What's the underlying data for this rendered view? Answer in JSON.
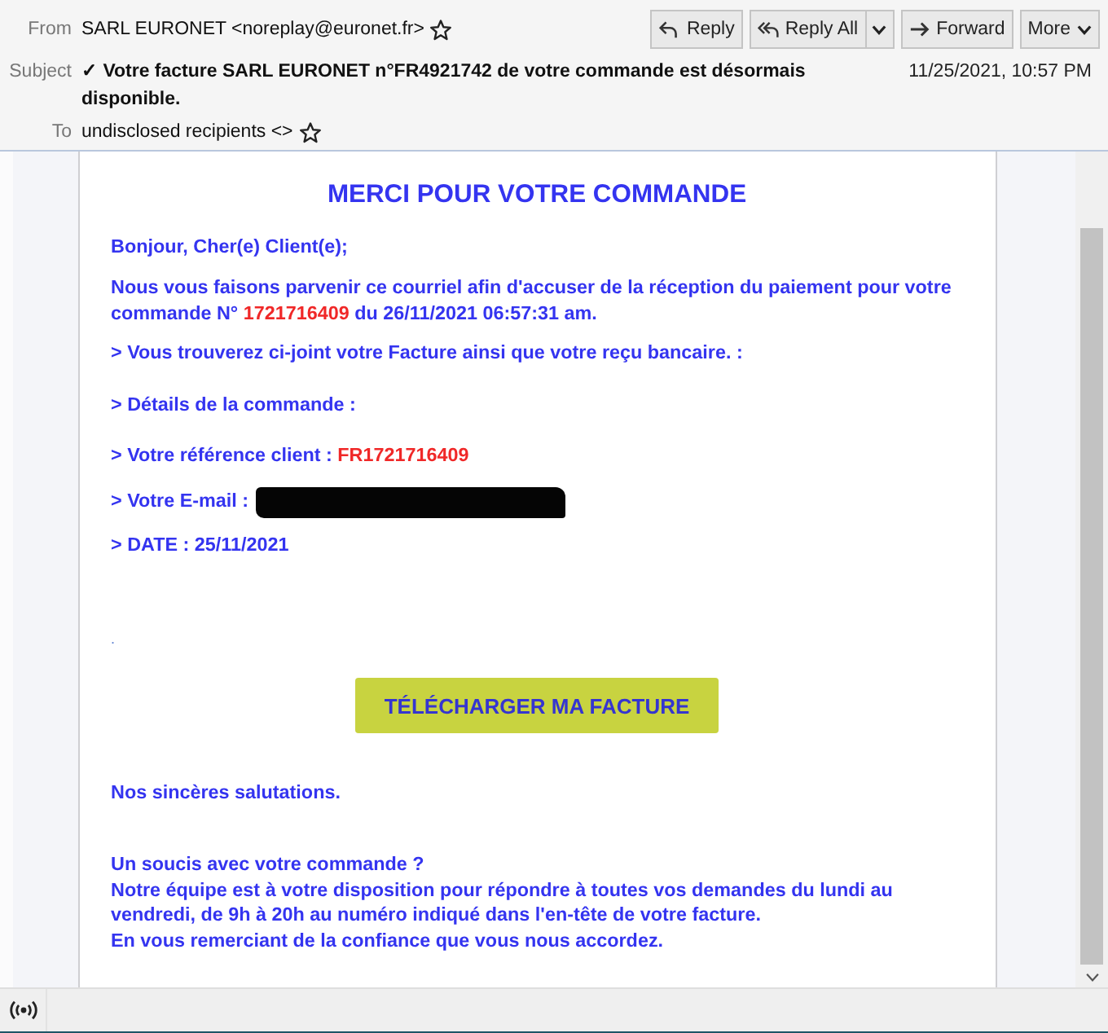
{
  "header": {
    "from": {
      "label": "From",
      "value": "SARL EURONET <noreplay@euronet.fr>",
      "starred": false
    },
    "subject": {
      "label": "Subject",
      "value": "✓ Votre facture SARL EURONET n°FR4921742 de votre commande est désormais disponible."
    },
    "date": "11/25/2021, 10:57 PM",
    "to": {
      "label": "To",
      "value": "undisclosed recipients <>",
      "starred": false
    }
  },
  "actions": [
    {
      "kind": "reply",
      "label": "Reply",
      "split_menu": false,
      "caret": false
    },
    {
      "kind": "reply_all",
      "label": "Reply All",
      "split_menu": true,
      "caret": false
    },
    {
      "kind": "forward",
      "label": "Forward",
      "split_menu": false,
      "caret": false
    },
    {
      "kind": "more",
      "label": "More",
      "split_menu": false,
      "caret": true
    }
  ],
  "blocks": [
    {
      "kind": "title",
      "text": "MERCI POUR VOTRE COMMANDE"
    },
    {
      "kind": "paragraph",
      "parts": [
        {
          "text": "Bonjour, Cher(e) Client(e);",
          "highlight": false
        }
      ]
    },
    {
      "kind": "paragraph",
      "parts": [
        {
          "text": "Nous vous faisons parvenir ce courriel afin d'accuser de la réception du paiement pour votre commande N° ",
          "highlight": false
        },
        {
          "text": "1721716409",
          "highlight": true
        },
        {
          "text": " du 26/11/2021 06:57:31 am.",
          "highlight": false
        }
      ]
    },
    {
      "kind": "paragraph",
      "parts": [
        {
          "text": "> Vous trouverez ci-joint votre Facture ainsi que votre reçu bancaire. :",
          "highlight": false
        }
      ]
    },
    {
      "kind": "paragraph",
      "parts": [
        {
          "text": "> Détails de la commande :",
          "highlight": false
        }
      ]
    },
    {
      "kind": "paragraph",
      "parts": [
        {
          "text": "> Votre référence client : ",
          "highlight": false
        },
        {
          "text": "FR1721716409",
          "highlight": true
        }
      ]
    },
    {
      "kind": "redacted",
      "label": "> Votre E-mail :"
    },
    {
      "kind": "paragraph",
      "parts": [
        {
          "text": "> DATE : 25/11/2021",
          "highlight": false
        }
      ]
    },
    {
      "kind": "note",
      "text": "."
    },
    {
      "kind": "button",
      "text": "TÉLÉCHARGER MA FACTURE"
    },
    {
      "kind": "paragraph",
      "parts": [
        {
          "text": "Nos sincères salutations.",
          "highlight": false
        }
      ]
    },
    {
      "kind": "lines",
      "lines": [
        "Un soucis avec votre commande ?",
        "Notre équipe est à votre disposition pour répondre à toutes vos demandes du lundi au vendredi, de 9h à 20h au numéro indiqué dans l'en-tête de votre facture.",
        "En vous remerciant de la confiance que vous nous accordez."
      ]
    }
  ]
}
